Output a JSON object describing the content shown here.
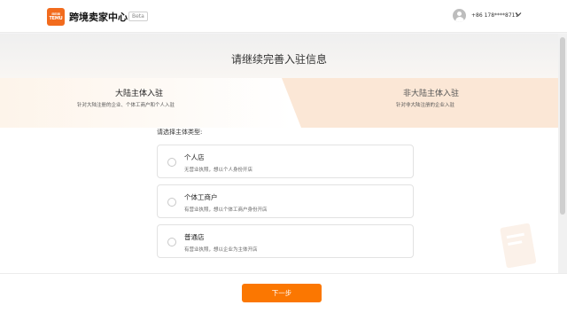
{
  "header": {
    "logo_text": "TEMU",
    "brand": "跨境卖家中心",
    "beta": "Beta",
    "phone": "+86 178****8711"
  },
  "main": {
    "title": "请继续完善入驻信息",
    "tabs": [
      {
        "title": "大陆主体入驻",
        "subtitle": "针对大陆注册的企业、个体工商户和个人入驻"
      },
      {
        "title": "非大陆主体入驻",
        "subtitle": "针对非大陆注册的企业入驻"
      }
    ],
    "type_label": "请选择主体类型:",
    "options": [
      {
        "title": "个人店",
        "subtitle": "无营业执照，想以个人身份开店"
      },
      {
        "title": "个体工商户",
        "subtitle": "有营业执照，想以个体工商户身份开店"
      },
      {
        "title": "普通店",
        "subtitle": "有营业执照，想以企业为主体开店"
      }
    ]
  },
  "footer": {
    "next_label": "下一步"
  },
  "colors": {
    "accent": "#fb7701",
    "brand": "#f26b1d",
    "active_tab": "#fdf4ea",
    "inactive_tab": "#fbe7d6"
  },
  "icons": [
    "temu-logo-icon",
    "user-avatar-icon",
    "chevron-down-icon",
    "radio-unchecked-icon",
    "document-decoration-icon"
  ]
}
